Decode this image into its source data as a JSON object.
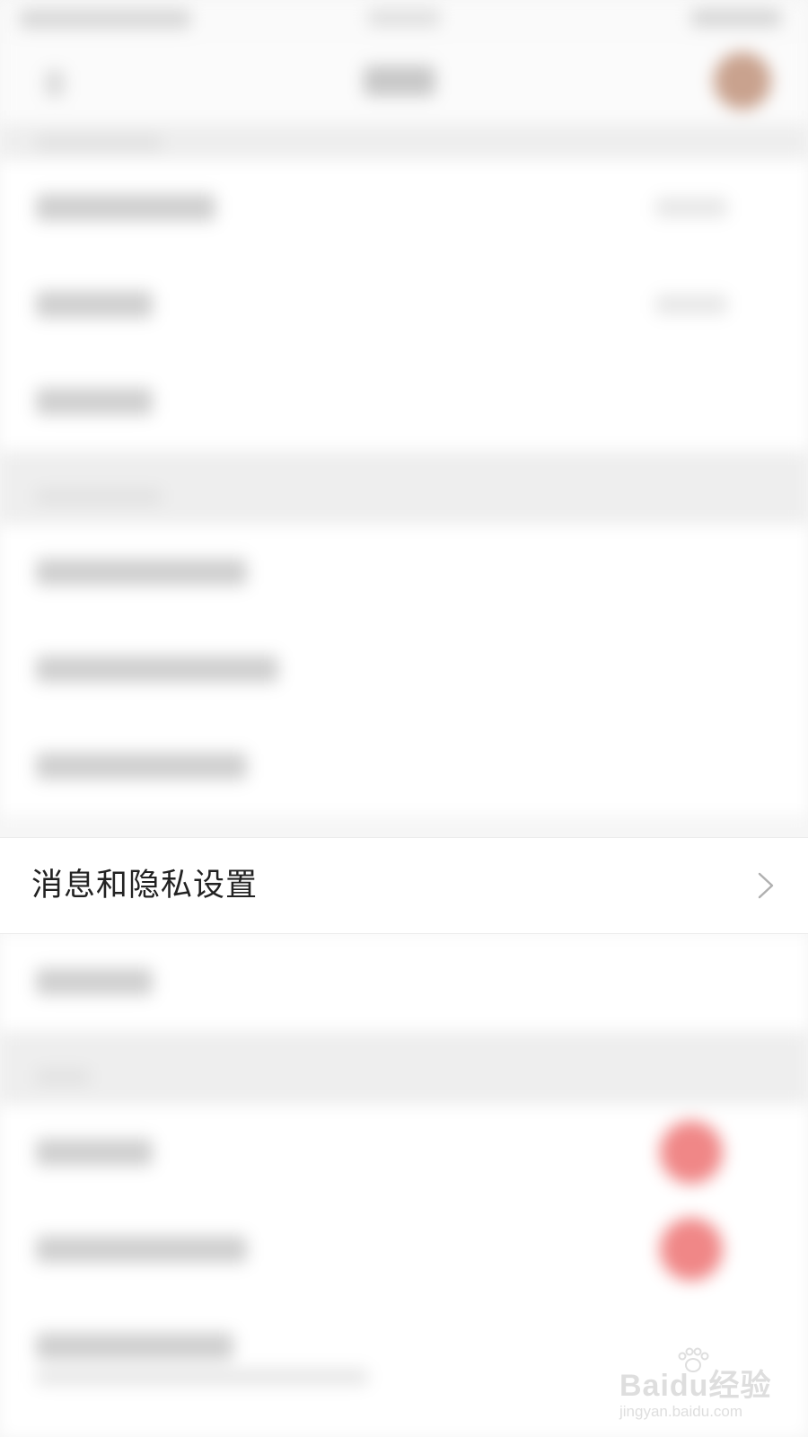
{
  "settings_row": {
    "label": "消息和隐私设置",
    "chevron_icon": "chevron-right-icon"
  },
  "watermark": {
    "brand": "Baidu经验",
    "url": "jingyan.baidu.com"
  },
  "colors": {
    "background": "#f5f5f5",
    "row_background": "#ffffff",
    "text": "#222222",
    "chevron": "#b0b0b0",
    "accent_badge": "#f08787"
  }
}
